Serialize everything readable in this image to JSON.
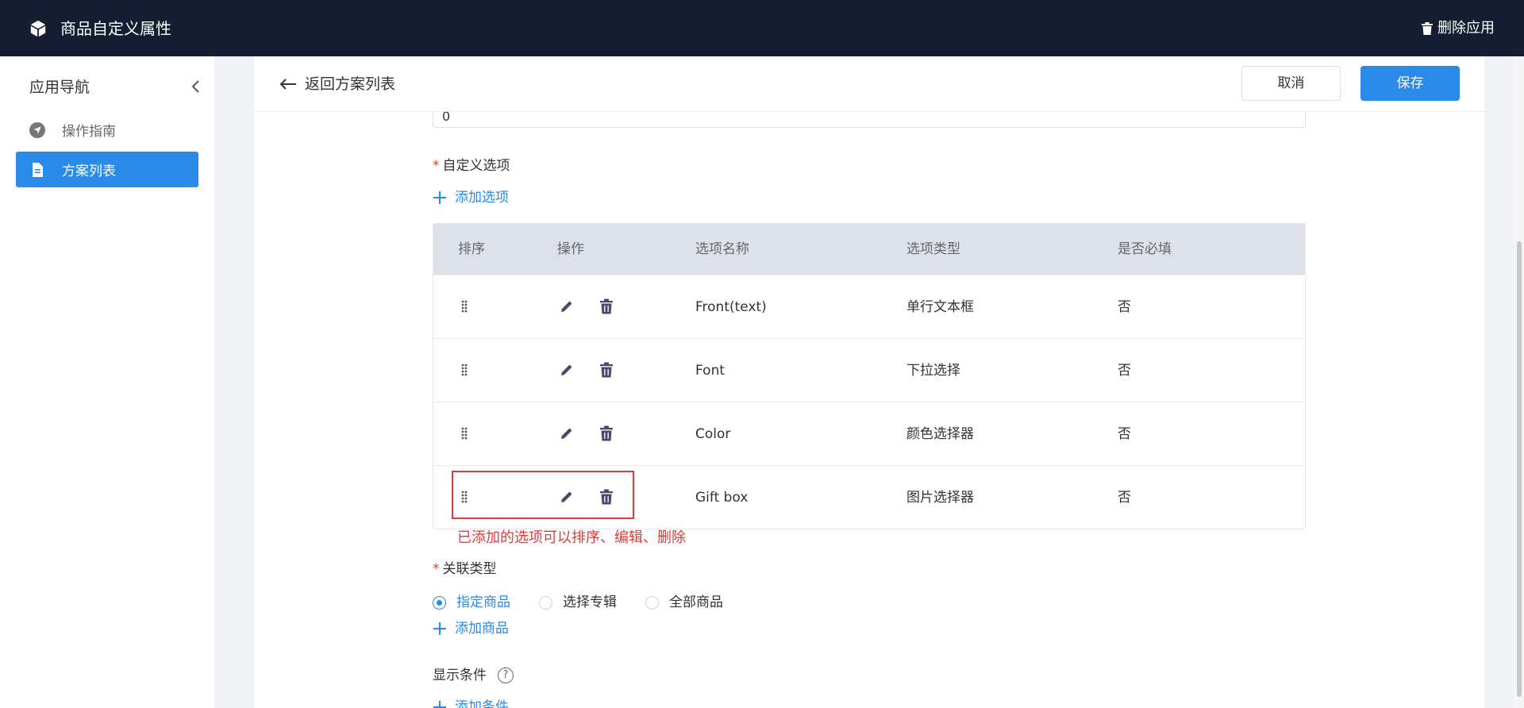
{
  "header": {
    "app_title": "商品自定义属性",
    "delete_app_label": "删除应用"
  },
  "sidebar": {
    "title": "应用导航",
    "items": [
      {
        "label": "操作指南",
        "icon": "navigation-icon",
        "active": false
      },
      {
        "label": "方案列表",
        "icon": "document-icon",
        "active": true
      }
    ]
  },
  "main": {
    "back_label": "返回方案列表",
    "cancel_label": "取消",
    "save_label": "保存",
    "prev_field_value": "0",
    "custom_options": {
      "label": "自定义选项",
      "required_mark": "*",
      "add_label": "添加选项",
      "columns": [
        "排序",
        "操作",
        "选项名称",
        "选项类型",
        "是否必填"
      ],
      "rows": [
        {
          "name": "Front(text)",
          "type": "单行文本框",
          "required": "否"
        },
        {
          "name": "Font",
          "type": "下拉选择",
          "required": "否"
        },
        {
          "name": "Color",
          "type": "颜色选择器",
          "required": "否"
        },
        {
          "name": "Gift box",
          "type": "图片选择器",
          "required": "否"
        }
      ]
    },
    "annotation_note": "已添加的选项可以排序、编辑、删除",
    "association": {
      "label": "关联类型",
      "required_mark": "*",
      "options": [
        "指定商品",
        "选择专辑",
        "全部商品"
      ],
      "selected": "指定商品",
      "add_label": "添加商品"
    },
    "display_condition": {
      "label": "显示条件",
      "help": "?",
      "add_label": "添加条件"
    }
  },
  "colors": {
    "topbar": "#151d33",
    "primary": "#2a8ae8",
    "danger": "#e53935",
    "table_header": "#dde2ea"
  }
}
